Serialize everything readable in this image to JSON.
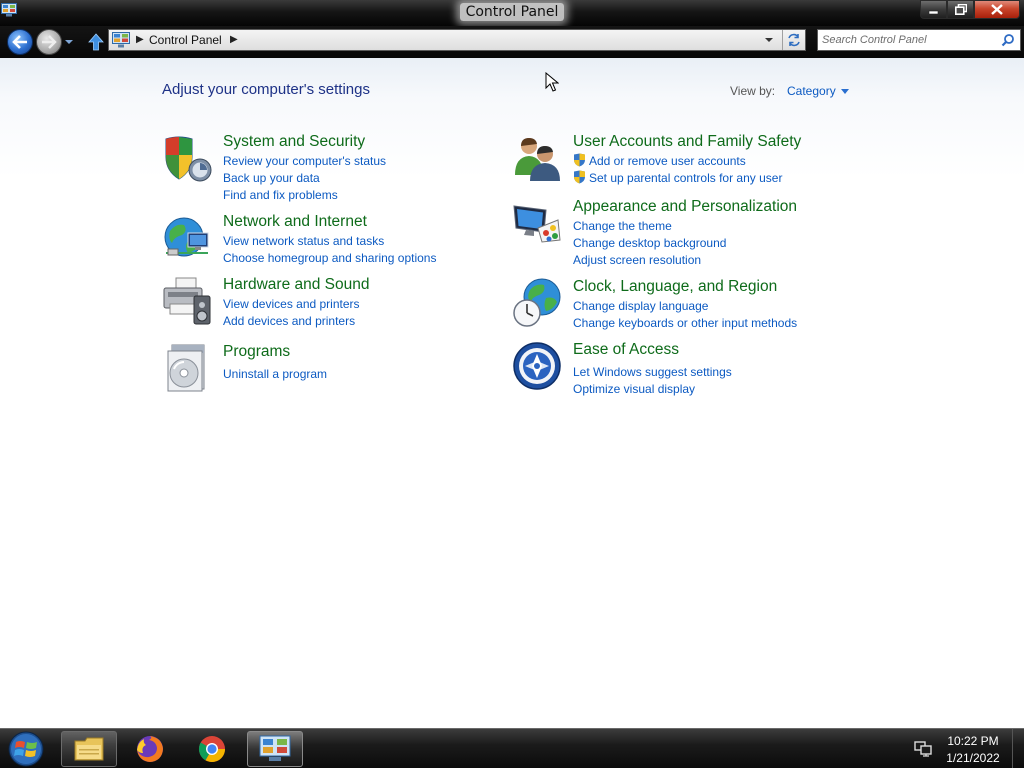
{
  "window": {
    "title": "Control Panel",
    "icon": "control-panel-icon",
    "controls": [
      "minimize-icon",
      "maximize-icon",
      "close-icon"
    ]
  },
  "address_bar": {
    "path": "Control Panel",
    "location_icon": "control-panel-icon",
    "search_placeholder": "Search Control Panel"
  },
  "content": {
    "heading": "Adjust your computer's settings",
    "view_by_label": "View by:",
    "view_by_value": "Category",
    "categories_left": [
      {
        "title": "System and Security",
        "icon": "system-security-shield-icon",
        "links": [
          "Review your computer's status",
          "Back up your data",
          "Find and fix problems"
        ]
      },
      {
        "title": "Network and Internet",
        "icon": "network-globe-icon",
        "links": [
          "View network status and tasks",
          "Choose homegroup and sharing options"
        ]
      },
      {
        "title": "Hardware and Sound",
        "icon": "printer-speaker-icon",
        "links": [
          "View devices and printers",
          "Add devices and printers"
        ]
      },
      {
        "title": "Programs",
        "icon": "programs-disc-icon",
        "links": [
          "Uninstall a program"
        ]
      }
    ],
    "categories_right": [
      {
        "title": "User Accounts and Family Safety",
        "icon": "users-icon",
        "links": [
          "Add or remove user accounts",
          "Set up parental controls for any user"
        ]
      },
      {
        "title": "Appearance and Personalization",
        "icon": "monitor-palette-icon",
        "links": [
          "Change the theme",
          "Change desktop background",
          "Adjust screen resolution"
        ]
      },
      {
        "title": "Clock, Language, and Region",
        "icon": "clock-globe-icon",
        "links": [
          "Change display language",
          "Change keyboards or other input methods"
        ]
      },
      {
        "title": "Ease of Access",
        "icon": "ease-of-access-icon",
        "links": [
          "Let Windows suggest settings",
          "Optimize visual display"
        ]
      }
    ]
  },
  "taskbar": {
    "items": [
      "start-orb-icon",
      "file-explorer-icon",
      "firefox-icon",
      "chrome-icon",
      "control-panel-icon"
    ],
    "active_item": "control-panel-icon",
    "time": "10:22 PM",
    "date": "1/21/2022"
  },
  "colors": {
    "link": "#0c5ac2",
    "category_title": "#0e6b1a",
    "heading": "#1e3287"
  }
}
